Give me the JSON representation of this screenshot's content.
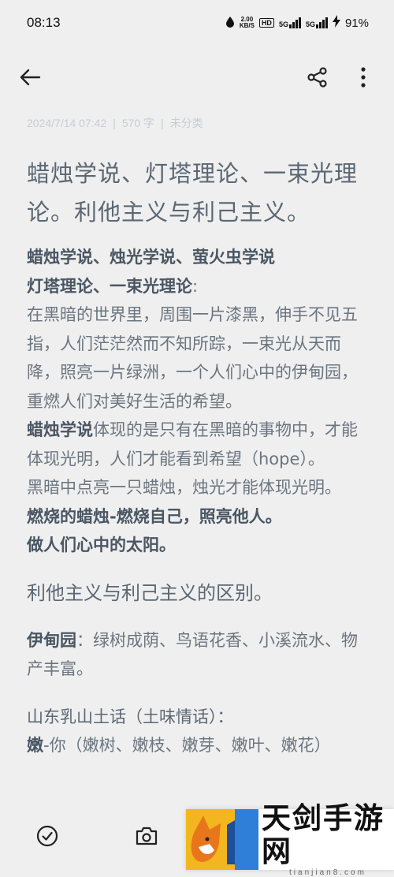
{
  "status_bar": {
    "time": "08:13",
    "speed_value": "2.00",
    "speed_unit": "KB/S",
    "hd_label": "HD",
    "sim1_label": "5G",
    "sim2_label": "5G",
    "battery": "91%"
  },
  "toolbar": {
    "back_icon": "arrow-left-icon",
    "share_icon": "share-icon",
    "more_icon": "more-vertical-icon"
  },
  "meta": {
    "datetime": "2024/7/14 07:42",
    "word_count": "570 字",
    "category": "未分类",
    "separator": "|"
  },
  "note": {
    "title": "蜡烛学说、灯塔理论、一束光理论。利他主义与利己主义。",
    "line1": "蜡烛学说、烛光学说、萤火虫学说",
    "line2_bold": "灯塔理论、一束光理论",
    "line2_rest": ":",
    "para1": "在黑暗的世界里，周围一片漆黑，伸手不见五指，人们茫茫然而不知所踪，一束光从天而降，照亮一片绿洲，一个人们心中的伊甸园，重燃人们对美好生活的希望。",
    "para2_bold": "蜡烛学说",
    "para2_rest": "体现的是只有在黑暗的事物中，才能体现光明，人们才能看到希望（hope）。",
    "para3": "黑暗中点亮一只蜡烛，烛光才能体现光明。",
    "line_burn": "燃烧的蜡烛-燃烧自己，照亮他人。",
    "line_sun": "做人们心中的太阳。",
    "heading2": "利他主义与利己主义的区别。",
    "eden_label": "伊甸园",
    "eden_text": "：绿树成荫、鸟语花香、小溪流水、物产丰富。",
    "heading3": "山东乳山土话（土味情话）：",
    "nen_bold": "嫩",
    "nen_text": "-你（嫩树、嫩枝、嫩芽、嫩叶、嫩花）"
  },
  "bottom_bar": {
    "check_icon": "checklist-icon",
    "camera_icon": "camera-icon"
  },
  "watermark": {
    "brand": "天剑手游网",
    "url": "tianjian8.com",
    "logo_icon": "fox-logo-icon"
  }
}
